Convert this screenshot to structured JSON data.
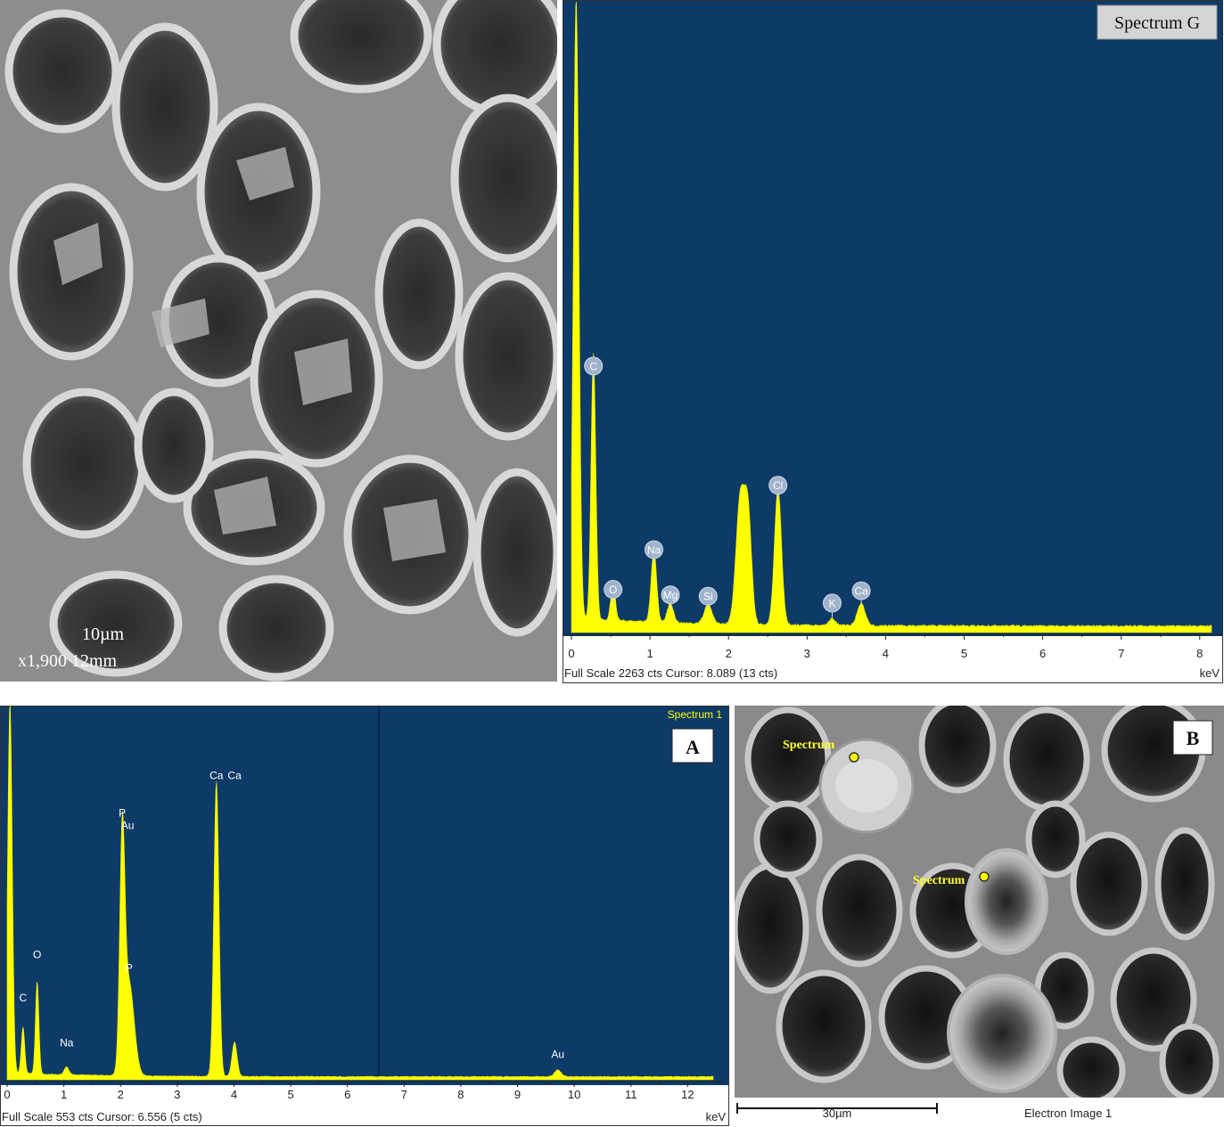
{
  "sem_top": {
    "scale_label": "10µm",
    "meta": "x1,900  12mm"
  },
  "sem_bottom": {
    "panel_letter": "B",
    "spectrum_markers": [
      "Spectrum",
      "Spectrum"
    ],
    "scale_label": "30µm",
    "image_title": "Electron Image 1"
  },
  "chart_data": [
    {
      "type": "line",
      "title": "Spectrum G",
      "xlabel": "keV",
      "xlim": [
        0,
        8.15
      ],
      "ylim": [
        0,
        2263
      ],
      "x_ticks": [
        "0",
        "1",
        "2",
        "3",
        "4",
        "5",
        "6",
        "7",
        "8"
      ],
      "footer": "Full Scale 2263 cts Cursor: 8.089  (13 cts)",
      "peaks": [
        {
          "label": "",
          "x": 0.06,
          "y": 2263,
          "w": 0.035
        },
        {
          "label": "C",
          "x": 0.28,
          "y": 970,
          "w": 0.03
        },
        {
          "label": "O",
          "x": 0.53,
          "y": 130,
          "w": 0.03
        },
        {
          "label": "Na",
          "x": 1.05,
          "y": 260,
          "w": 0.035
        },
        {
          "label": "Mg",
          "x": 1.26,
          "y": 70,
          "w": 0.04
        },
        {
          "label": "Si",
          "x": 1.74,
          "y": 70,
          "w": 0.05
        },
        {
          "label": "",
          "x": 2.15,
          "y": 460,
          "w": 0.055
        },
        {
          "label": "",
          "x": 2.25,
          "y": 380,
          "w": 0.045
        },
        {
          "label": "Cl",
          "x": 2.63,
          "y": 500,
          "w": 0.045
        },
        {
          "label": "K",
          "x": 3.32,
          "y": 25,
          "w": 0.04
        },
        {
          "label": "Ca",
          "x": 3.69,
          "y": 80,
          "w": 0.05
        }
      ],
      "labeled_peak_heights": {
        "C": 940,
        "O": 125,
        "Na": 270,
        "Mg": 105,
        "Si": 100,
        "Cl": 505,
        "K": 75,
        "Ca": 120
      },
      "baseline": 20
    },
    {
      "type": "line",
      "title": "Spectrum 1",
      "panel_letter": "A",
      "xlabel": "keV",
      "xlim": [
        0,
        12.45
      ],
      "ylim": [
        0,
        553
      ],
      "x_ticks": [
        "0",
        "1",
        "2",
        "3",
        "4",
        "5",
        "6",
        "7",
        "8",
        "9",
        "10",
        "11",
        "12"
      ],
      "footer": "Full Scale 553 cts Cursor: 6.556  (5 cts)",
      "cursor_x": 6.556,
      "peaks": [
        {
          "label": "",
          "x": 0.05,
          "y": 560,
          "w": 0.04
        },
        {
          "label": "C",
          "x": 0.28,
          "y": 70,
          "w": 0.03
        },
        {
          "label": "O",
          "x": 0.53,
          "y": 140,
          "w": 0.03
        },
        {
          "label": "Na",
          "x": 1.05,
          "y": 12,
          "w": 0.04
        },
        {
          "label": "P\nAu",
          "x": 2.03,
          "y": 340,
          "w": 0.045
        },
        {
          "label": "P",
          "x": 2.15,
          "y": 140,
          "w": 0.09
        },
        {
          "label": "Ca",
          "x": 3.69,
          "y": 445,
          "w": 0.045
        },
        {
          "label": "Ca",
          "x": 4.01,
          "y": 52,
          "w": 0.045
        },
        {
          "label": "Au",
          "x": 9.71,
          "y": 10,
          "w": 0.06
        }
      ],
      "labeled_peak_heights": {
        "C": 110,
        "O": 175,
        "Na": 42,
        "P\nAu": 370,
        "P": 155,
        "Ca": 445,
        "Au": 25
      },
      "label_offsets": {
        "Ca": [
          0,
          0
        ]
      },
      "baseline": 4
    }
  ]
}
